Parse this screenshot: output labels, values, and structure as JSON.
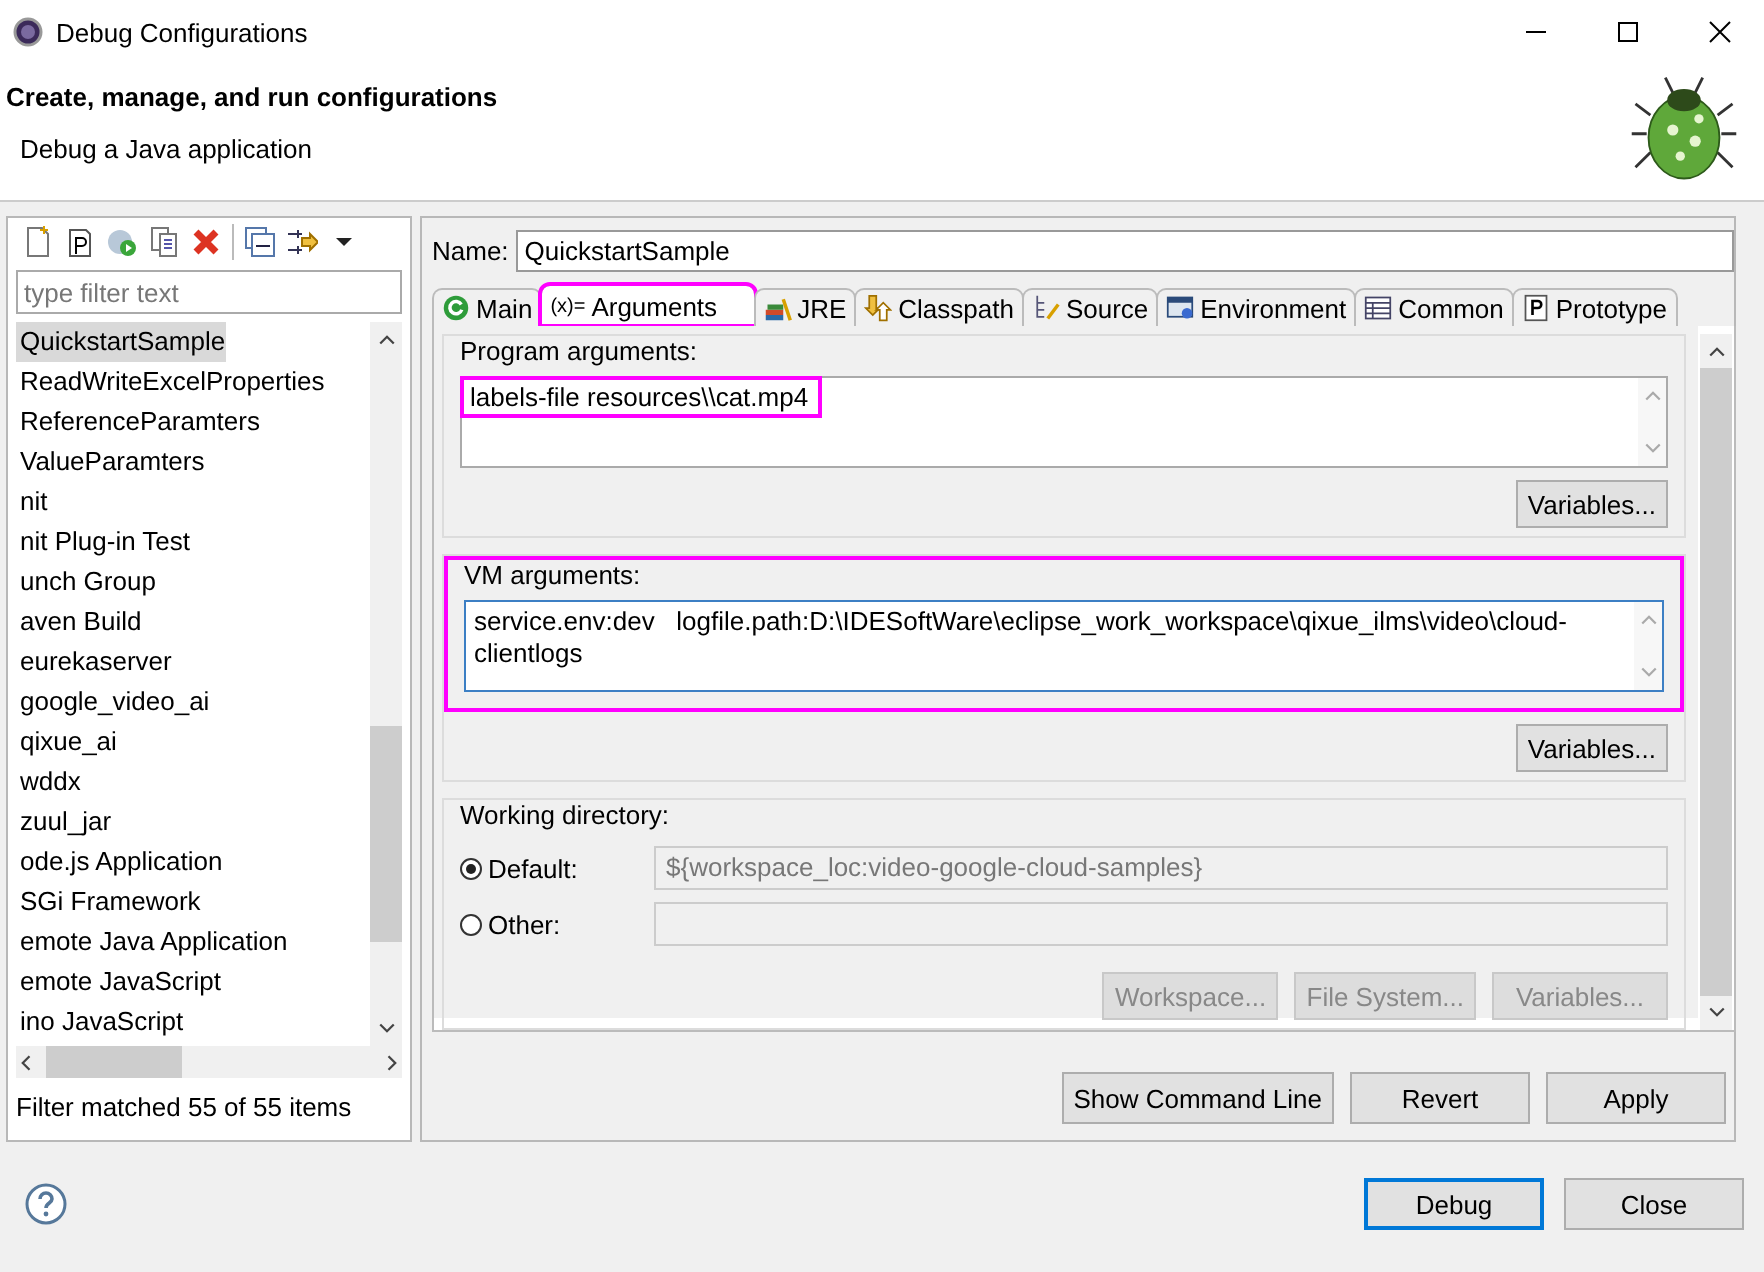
{
  "window": {
    "title": "Debug Configurations"
  },
  "header": {
    "title": "Create, manage, and run configurations",
    "subtitle": "Debug a Java application"
  },
  "filter": {
    "placeholder": "type filter text"
  },
  "tree": {
    "items": [
      {
        "label": "QuickstartSample",
        "selected": true
      },
      {
        "label": "ReadWriteExcelProperties",
        "selected": false
      },
      {
        "label": "ReferenceParamters",
        "selected": false
      },
      {
        "label": "ValueParamters",
        "selected": false
      },
      {
        "label": "nit",
        "selected": false
      },
      {
        "label": "nit Plug-in Test",
        "selected": false
      },
      {
        "label": "unch Group",
        "selected": false
      },
      {
        "label": "aven Build",
        "selected": false
      },
      {
        "label": "eurekaserver",
        "selected": false
      },
      {
        "label": "google_video_ai",
        "selected": false
      },
      {
        "label": "qixue_ai",
        "selected": false
      },
      {
        "label": "wddx",
        "selected": false
      },
      {
        "label": "zuul_jar",
        "selected": false
      },
      {
        "label": "ode.js Application",
        "selected": false
      },
      {
        "label": "SGi Framework",
        "selected": false
      },
      {
        "label": "emote Java Application",
        "selected": false
      },
      {
        "label": "emote JavaScript",
        "selected": false
      },
      {
        "label": "ino JavaScript",
        "selected": false
      }
    ]
  },
  "status": "Filter matched 55 of 55 items",
  "name": {
    "label": "Name:",
    "value": "QuickstartSample"
  },
  "tabs": [
    {
      "label": "Main",
      "kind": "main",
      "selected": false,
      "highlighted": false
    },
    {
      "label": "Arguments",
      "glyph": "(x)=",
      "selected": true,
      "highlighted": true
    },
    {
      "label": "JRE",
      "kind": "jre",
      "selected": false,
      "highlighted": false
    },
    {
      "label": "Classpath",
      "kind": "classpath",
      "selected": false,
      "highlighted": false
    },
    {
      "label": "Source",
      "kind": "source",
      "selected": false,
      "highlighted": false
    },
    {
      "label": "Environment",
      "kind": "environment",
      "selected": false,
      "highlighted": false
    },
    {
      "label": "Common",
      "kind": "common",
      "selected": false,
      "highlighted": false
    },
    {
      "label": "Prototype",
      "kind": "prototype",
      "selected": false,
      "highlighted": false
    }
  ],
  "program_arguments": {
    "label": "Program arguments:",
    "value": "labels-file resources\\\\cat.mp4",
    "highlighted": true,
    "button": "Variables..."
  },
  "vm_arguments": {
    "label": "VM arguments:",
    "value": "service.env:dev   logfile.path:D:\\IDESoftWare\\eclipse_work_workspace\\qixue_ilms\\video\\cloud-clientlogs",
    "highlighted": true,
    "button": "Variables..."
  },
  "working_directory": {
    "label": "Working directory:",
    "options": [
      {
        "label": "Default:",
        "selected": true,
        "value": "${workspace_loc:video-google-cloud-samples}"
      },
      {
        "label": "Other:",
        "selected": false
      }
    ],
    "buttons": [
      {
        "label": "Workspace...",
        "disabled": true
      },
      {
        "label": "File System...",
        "disabled": true
      },
      {
        "label": "Variables...",
        "disabled": true
      }
    ]
  },
  "actions": [
    {
      "label": "Show Command Line",
      "disabled": false
    },
    {
      "label": "Revert",
      "disabled": false
    },
    {
      "label": "Apply",
      "disabled": false
    }
  ],
  "footer": {
    "buttons": [
      {
        "label": "Debug",
        "default": true
      },
      {
        "label": "Close",
        "default": false
      }
    ]
  }
}
